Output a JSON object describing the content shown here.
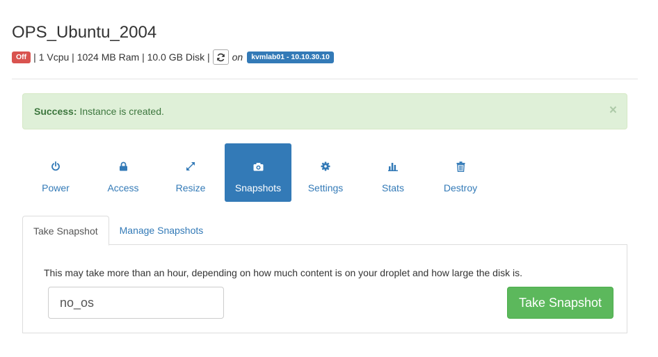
{
  "server": {
    "name": "OPS_Ubuntu_2004",
    "status": "Off",
    "specs": "| 1 Vcpu | 1024 MB Ram | 10.0 GB Disk |",
    "on_text": "on",
    "host": "kvmlab01 - 10.10.30.10"
  },
  "alert": {
    "strong": "Success:",
    "message": "Instance is created.",
    "close": "×"
  },
  "actions": [
    {
      "label": "Power",
      "icon": "power-icon"
    },
    {
      "label": "Access",
      "icon": "lock-icon"
    },
    {
      "label": "Resize",
      "icon": "resize-icon"
    },
    {
      "label": "Snapshots",
      "icon": "camera-icon",
      "active": true
    },
    {
      "label": "Settings",
      "icon": "gear-icon"
    },
    {
      "label": "Stats",
      "icon": "bar-chart-icon"
    },
    {
      "label": "Destroy",
      "icon": "trash-icon"
    }
  ],
  "tabs": [
    {
      "label": "Take Snapshot",
      "active": true
    },
    {
      "label": "Manage Snapshots"
    }
  ],
  "snapshot": {
    "description": "This may take more than an hour, depending on how much content is on your droplet and how large the disk is.",
    "input_value": "no_os",
    "button": "Take Snapshot"
  },
  "colors": {
    "primary": "#337ab7",
    "danger": "#d9534f",
    "success": "#5cb85c",
    "alert_bg": "#dff0d8"
  }
}
